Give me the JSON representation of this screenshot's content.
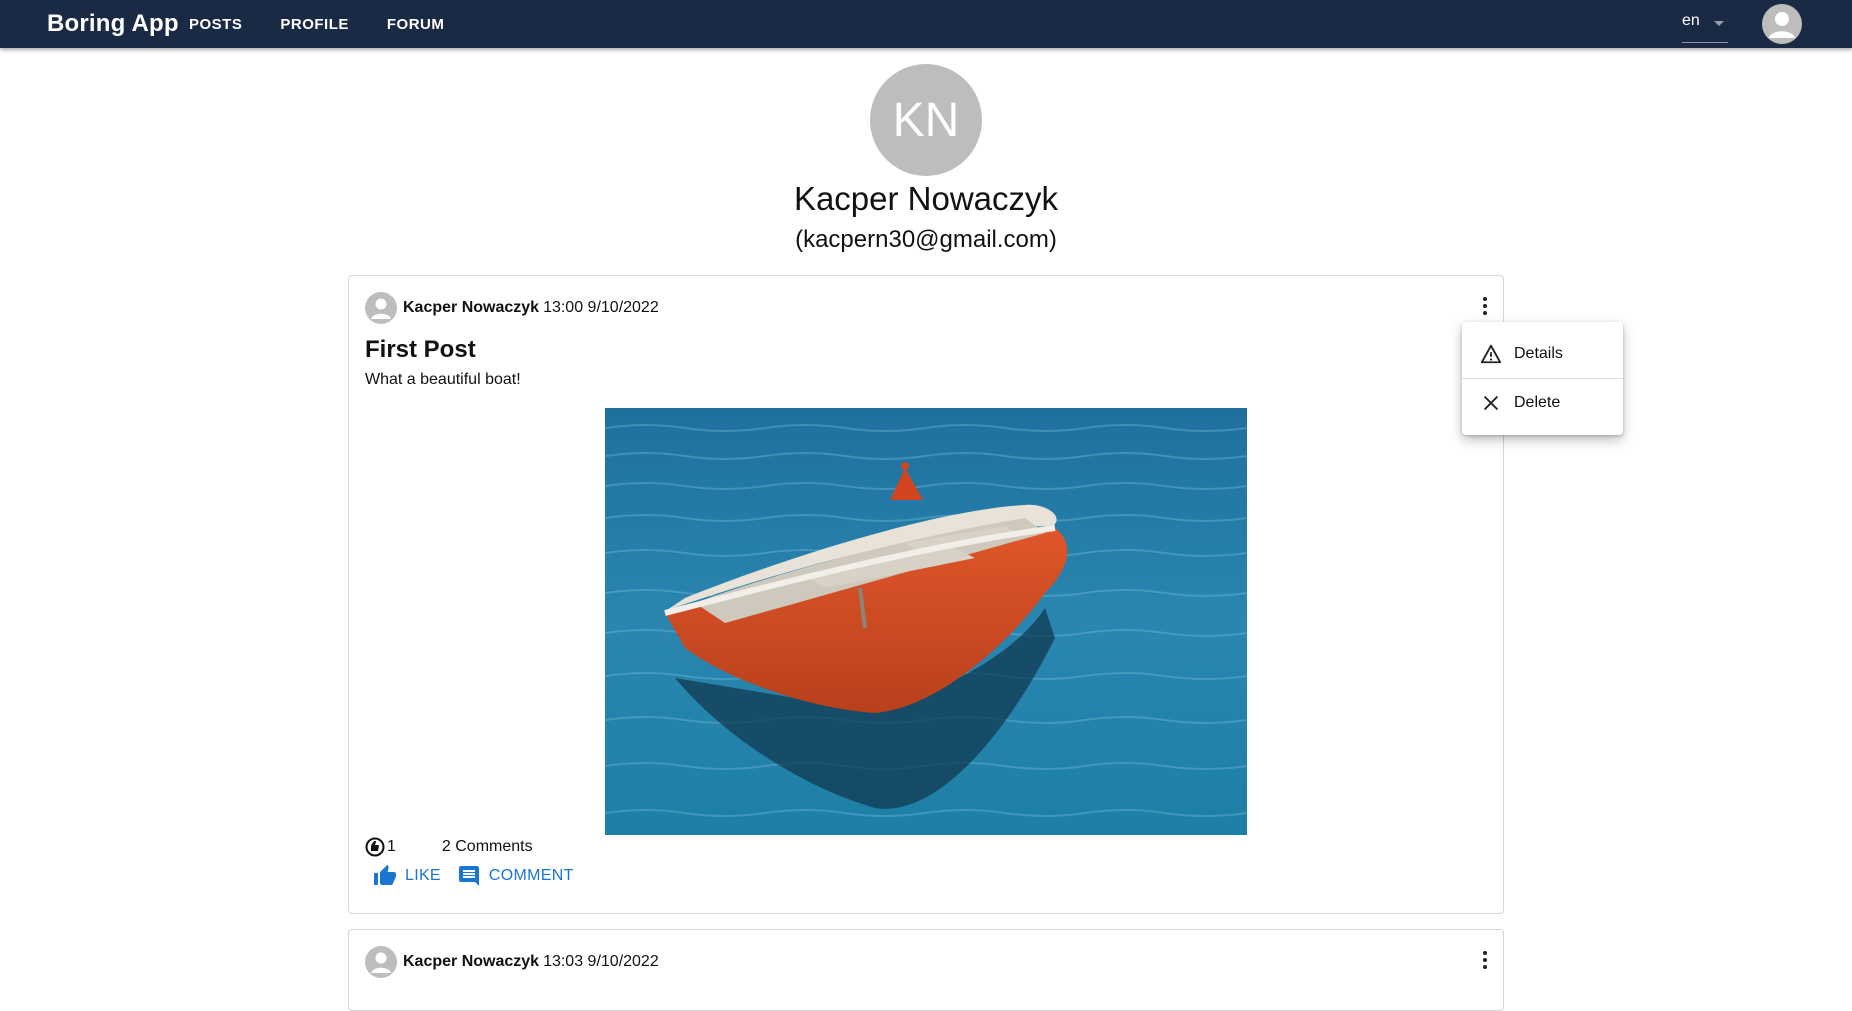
{
  "header": {
    "brand": "Boring App",
    "nav": [
      "POSTS",
      "PROFILE",
      "FORUM"
    ],
    "language": "en",
    "bg_color": "#1b2a44"
  },
  "profile": {
    "initials": "KN",
    "name": "Kacper Nowaczyk",
    "email": "(kacpern30@gmail.com)"
  },
  "posts": [
    {
      "author": "Kacper Nowaczyk",
      "datetime": "13:00 9/10/2022",
      "title": "First Post",
      "text": "What a beautiful boat!",
      "reactions": "1",
      "comments": "2 Comments",
      "like_label": "LIKE",
      "comment_label": "COMMENT"
    },
    {
      "author": "Kacper Nowaczyk",
      "datetime": "13:03 9/10/2022"
    }
  ],
  "context_menu": {
    "items": [
      "Details",
      "Delete"
    ]
  },
  "accent_color": "#1976d2"
}
